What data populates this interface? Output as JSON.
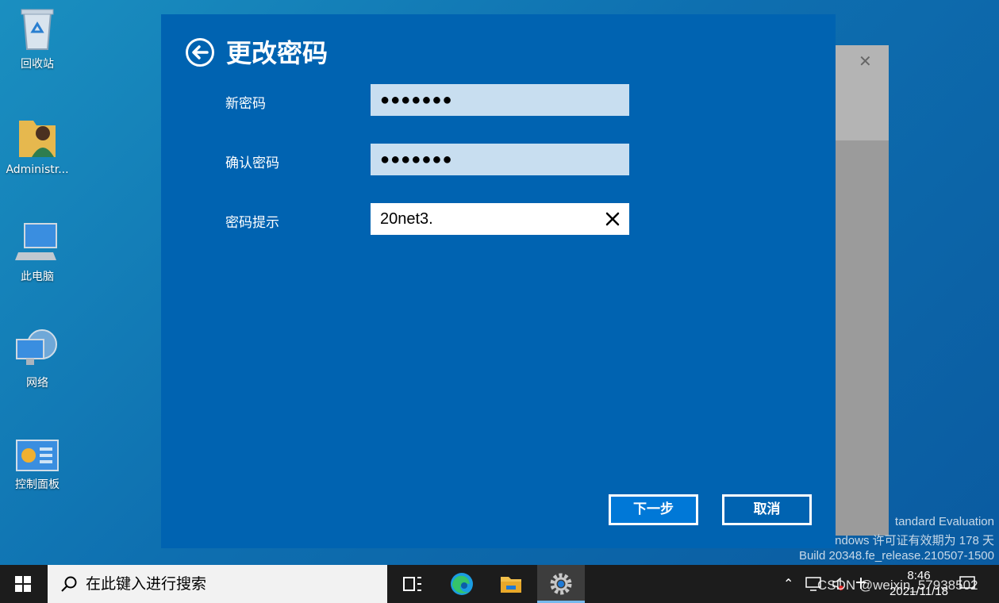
{
  "desktop": {
    "icons": [
      {
        "label": "回收站",
        "icon": "recycle-bin-icon"
      },
      {
        "label": "Administr...",
        "icon": "user-folder-icon"
      },
      {
        "label": "此电脑",
        "icon": "computer-icon"
      },
      {
        "label": "网络",
        "icon": "network-icon"
      },
      {
        "label": "控制面板",
        "icon": "control-panel-icon"
      }
    ],
    "watermark": {
      "line1": "tandard Evaluation",
      "line2": "ndows 许可证有效期为 178 天",
      "line3": "Build 20348.fe_release.210507-1500"
    }
  },
  "dialog": {
    "title": "更改密码",
    "fields": [
      {
        "label": "新密码",
        "value": "●●●●●●●"
      },
      {
        "label": "确认密码",
        "value": "●●●●●●●"
      },
      {
        "label": "密码提示",
        "value": "20net3."
      }
    ],
    "buttons": {
      "next": "下一步",
      "cancel": "取消"
    }
  },
  "taskbar": {
    "search_placeholder": "在此键入进行搜索",
    "apps": [
      "task-view-icon",
      "edge-icon",
      "file-explorer-icon",
      "settings-icon"
    ],
    "tray": {
      "time": "8:46",
      "date": "2021/11/18",
      "overlay_text": "CSDN @weixin_57938502"
    }
  },
  "colors": {
    "dialog_bg": "#0063b1",
    "field_bg": "#c8def0",
    "accent": "#0078d7"
  }
}
